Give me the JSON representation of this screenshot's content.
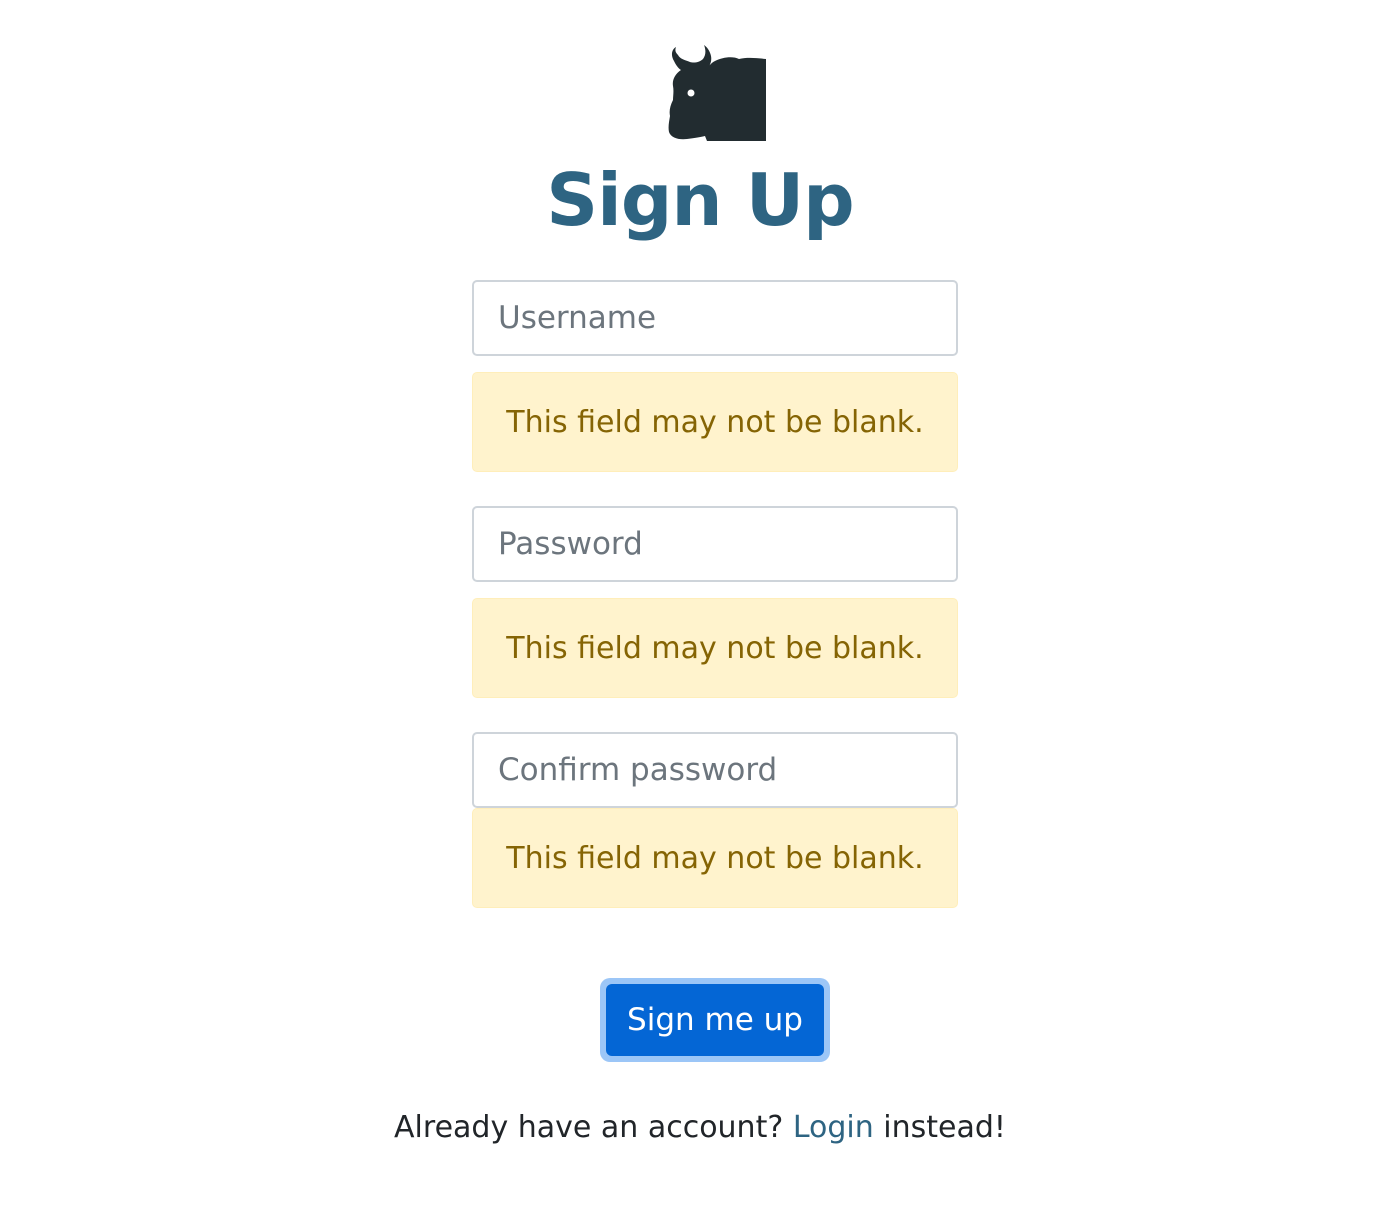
{
  "logo": {
    "icon": "bison-icon",
    "color": "#222c30"
  },
  "title": "Sign Up",
  "fields": [
    {
      "placeholder": "Username",
      "value": "",
      "error": "This field may not be blank."
    },
    {
      "placeholder": "Password",
      "value": "",
      "error": "This field may not be blank."
    },
    {
      "placeholder": "Confirm password",
      "value": "",
      "error": "This field may not be blank."
    }
  ],
  "submit_label": "Sign me up",
  "footer": {
    "prefix": "Already have an account?",
    "link_label": "Login",
    "suffix": "instead!"
  },
  "colors": {
    "title": "#2e6482",
    "primary_button": "#0466d5",
    "warning_background": "#fff3cd",
    "warning_text": "#856404",
    "link": "#2e6482"
  }
}
